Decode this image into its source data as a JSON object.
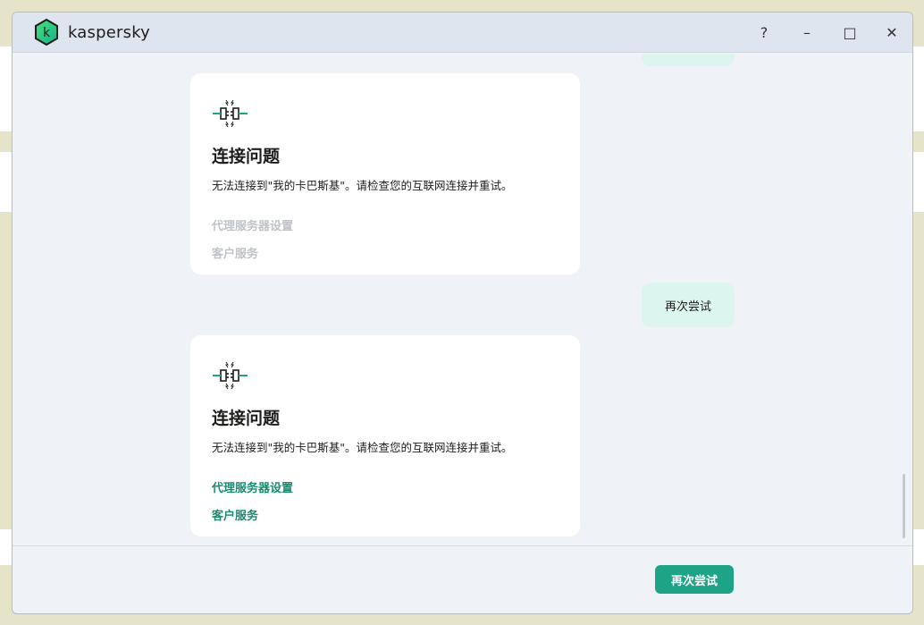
{
  "app": {
    "brand": "kaspersky"
  },
  "window_controls": {
    "help": "?",
    "minimize": "–",
    "maximize": "□",
    "close": "✕"
  },
  "messages": [
    {
      "type": "error",
      "icon": "connection-broken-icon",
      "title": "连接问题",
      "text": "无法连接到\"我的卡巴斯基\"。请检查您的互联网连接并重试。",
      "links": [
        "代理服务器设置",
        "客户服务"
      ],
      "links_enabled": false
    },
    {
      "type": "user",
      "text": "再次尝试"
    },
    {
      "type": "error",
      "icon": "connection-broken-icon",
      "title": "连接问题",
      "text": "无法连接到\"我的卡巴斯基\"。请检查您的互联网连接并重试。",
      "links": [
        "代理服务器设置",
        "客户服务"
      ],
      "links_enabled": true
    }
  ],
  "footer": {
    "retry_label": "再次尝试"
  },
  "colors": {
    "accent": "#1fa387",
    "link": "#1a8a6e",
    "bubble": "#dcf5ef"
  }
}
